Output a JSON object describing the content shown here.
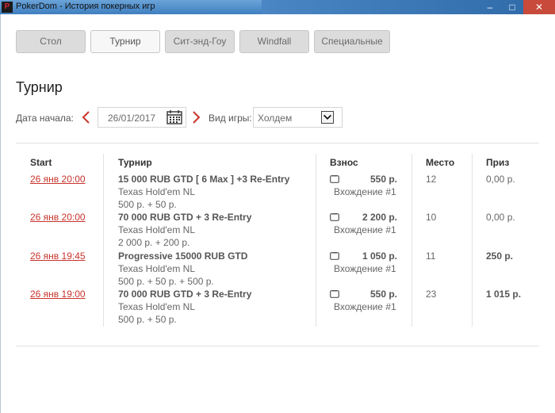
{
  "window": {
    "title": "PokerDom - История покерных игр",
    "icon_letter": "P"
  },
  "tabs": [
    {
      "label": "Стол"
    },
    {
      "label": "Турнир"
    },
    {
      "label": "Сит-энд-Гоу"
    },
    {
      "label": "Windfall"
    },
    {
      "label": "Специальные"
    }
  ],
  "page_title": "Турнир",
  "filters": {
    "date_label": "Дата начала:",
    "date_value": "26/01/2017",
    "game_label": "Вид игры:",
    "game_value": "Холдем"
  },
  "table": {
    "headers": [
      "Start",
      "Турнир",
      "Взнос",
      "Место",
      "Приз"
    ],
    "rows": [
      {
        "date": "26 янв 20:00",
        "name": "15 000 RUB GTD [ 6 Max ] +3 Re-Entry",
        "game": "Texas Hold'em NL",
        "price": "500 р. + 50 р.",
        "fee": "550 р.",
        "entry": "Вхождение #1",
        "place": "12",
        "prize": "0,00 р."
      },
      {
        "date": "26 янв 20:00",
        "name": "70 000 RUB GTD + 3 Re-Entry",
        "game": "Texas Hold'em NL",
        "price": "2 000 р. + 200 р.",
        "fee": "2 200 р.",
        "entry": "Вхождение #1",
        "place": "10",
        "prize": "0,00 р."
      },
      {
        "date": "26 янв 19:45",
        "name": "Progressive 15000 RUB GTD",
        "game": "Texas Hold'em NL",
        "price": "500 р. + 50 р. + 500 р.",
        "fee": "1 050 р.",
        "entry": "Вхождение #1",
        "place": "11",
        "prize": "250 р."
      },
      {
        "date": "26 янв 19:00",
        "name": "70 000 RUB GTD + 3 Re-Entry",
        "game": "Texas Hold'em NL",
        "price": "500 р. + 50 р.",
        "fee": "550 р.",
        "entry": "Вхождение #1",
        "place": "23",
        "prize": "1 015 р."
      }
    ]
  },
  "colors": {
    "accent": "#c8342c",
    "tab_bg": "#dcdcdc",
    "titlebar": "#3f7fc0",
    "close_button": "#c74a3a"
  },
  "icons": [
    "app-logo",
    "chevron-left-icon",
    "calendar-icon",
    "chevron-right-icon",
    "dropdown-arrow-icon",
    "wallet-icon",
    "minimize-icon",
    "maximize-icon",
    "close-icon"
  ]
}
